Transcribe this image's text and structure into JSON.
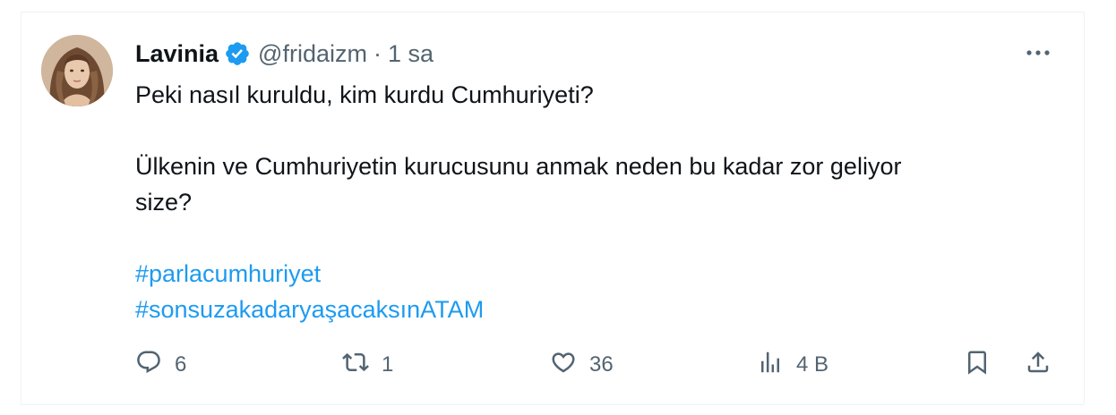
{
  "tweet": {
    "author_name": "Lavinia",
    "handle": "@fridaizm",
    "separator": "·",
    "time": "1 sa",
    "text_line_1": "Peki nasıl kuruldu, kim kurdu Cumhuriyeti?",
    "text_line_2": "Ülkenin ve Cumhuriyetin kurucusunu anmak neden bu kadar zor geliyor",
    "text_line_3": "size?",
    "hashtags": [
      "#parlacumhuriyet",
      "#sonsuzakadaryaşacaksınATAM"
    ]
  },
  "actions": {
    "reply_count": "6",
    "retweet_count": "1",
    "like_count": "36",
    "views_count": "4 B"
  },
  "colors": {
    "accent": "#1d9bf0",
    "secondary_text": "#536471",
    "primary_text": "#0f1419",
    "border": "#eff3f4"
  },
  "icons": [
    "verified-badge-icon",
    "more-icon",
    "reply-icon",
    "retweet-icon",
    "like-icon",
    "views-icon",
    "bookmark-icon",
    "share-icon"
  ]
}
